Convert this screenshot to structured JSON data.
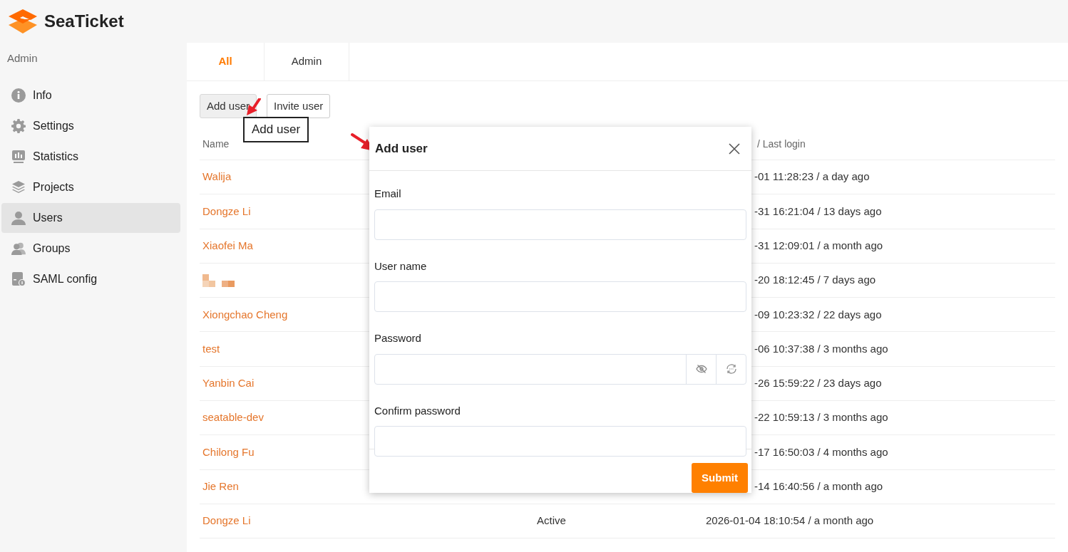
{
  "brand": {
    "name": "SeaTicket"
  },
  "sidebar": {
    "heading": "Admin",
    "items": [
      {
        "label": "Info",
        "selected": false
      },
      {
        "label": "Settings",
        "selected": false
      },
      {
        "label": "Statistics",
        "selected": false
      },
      {
        "label": "Projects",
        "selected": false
      },
      {
        "label": "Users",
        "selected": true
      },
      {
        "label": "Groups",
        "selected": false
      },
      {
        "label": "SAML config",
        "selected": false
      }
    ]
  },
  "tabs": [
    {
      "label": "All",
      "selected": true
    },
    {
      "label": "Admin",
      "selected": false
    }
  ],
  "actions": [
    {
      "label": "Add user",
      "pressed": true
    },
    {
      "label": "Invite user",
      "pressed": false
    }
  ],
  "annotation": {
    "callout": "Add user"
  },
  "table": {
    "columns": [
      "Name",
      "/ Last login"
    ],
    "rows": [
      {
        "kind": "user",
        "name": "Walija",
        "last_login": "-01 11:28:23 / a day ago"
      },
      {
        "kind": "user",
        "name": "Dongze Li",
        "last_login": "-31 16:21:04 / 13 days ago"
      },
      {
        "kind": "user",
        "name": "Xiaofei Ma",
        "last_login": "-31 12:09:01 / a month ago"
      },
      {
        "kind": "redacted",
        "last_login": "-20 18:12:45 / 7 days ago"
      },
      {
        "kind": "user",
        "name": "Xiongchao Cheng",
        "last_login": "-09 10:23:32 / 22 days ago"
      },
      {
        "kind": "user",
        "name": "test",
        "last_login": "-06 10:37:38 / 3 months ago"
      },
      {
        "kind": "user",
        "name": "Yanbin Cai",
        "last_login": "-26 15:59:22 / 23 days ago"
      },
      {
        "kind": "user",
        "name": "seatable-dev",
        "last_login": "-22 10:59:13 / 3 months ago"
      },
      {
        "kind": "user",
        "name": "Chilong Fu",
        "last_login": "-17 16:50:03 / 4 months ago"
      },
      {
        "kind": "user",
        "name": "Jie Ren",
        "last_login": "-14 16:40:56 / a month ago"
      },
      {
        "kind": "user",
        "name": "Dongze Li",
        "status": "Active",
        "last_login": "2026-01-04 18:10:54 / a month ago"
      }
    ]
  },
  "dialog": {
    "title": "Add user",
    "fields": [
      {
        "label": "Email",
        "kind": "text"
      },
      {
        "label": "User name",
        "kind": "text"
      },
      {
        "label": "Password",
        "kind": "password"
      },
      {
        "label": "Confirm password",
        "kind": "text"
      }
    ],
    "submit": "Submit"
  }
}
